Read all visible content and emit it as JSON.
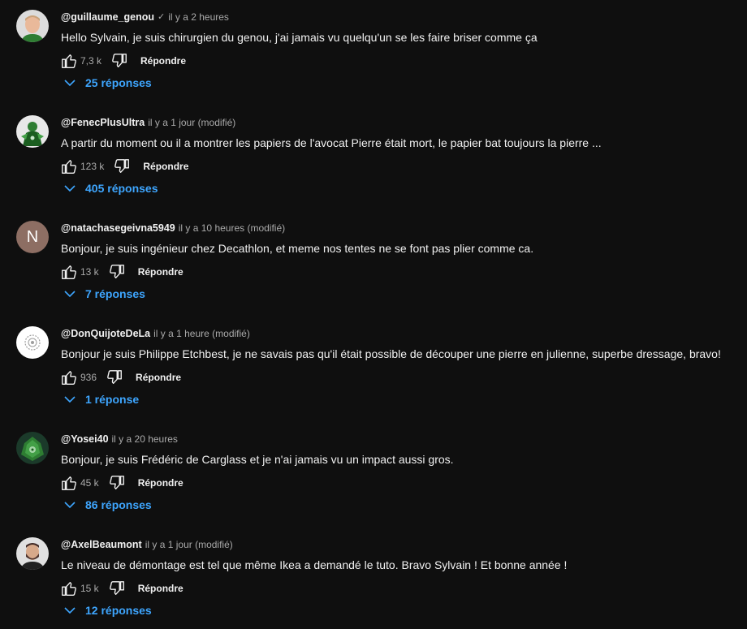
{
  "comments": [
    {
      "author": "@guillaume_genou",
      "verified": "✓",
      "time": "il y a 2 heures",
      "text": "Hello Sylvain, je suis chirurgien du genou, j'ai jamais vu quelqu'un se les faire briser comme ça",
      "likes": "7,3 k",
      "reply_label": "Répondre",
      "replies": "25 réponses",
      "avatar": "man-face"
    },
    {
      "author": "@FenecPlusUltra",
      "time": "il y a 1 jour (modifié)",
      "text": "A partir du moment ou il a montrer les papiers de l'avocat Pierre était mort, le papier bat toujours la pierre ...",
      "likes": "123 k",
      "reply_label": "Répondre",
      "replies": "405 réponses",
      "avatar": "green-hero"
    },
    {
      "author": "@natachasegeivna5949",
      "time": "il y a 10 heures (modifié)",
      "text": "Bonjour, je suis ingénieur chez Decathlon, et meme nos tentes ne se font pas plier comme ca.",
      "likes": "13 k",
      "reply_label": "Répondre",
      "replies": "7 réponses",
      "avatar_letter": "N",
      "avatar_color": "#8d6e63"
    },
    {
      "author": "@DonQuijoteDeLa",
      "time": "il y a 1 heure (modifié)",
      "text": "Bonjour je suis Philippe Etchbest, je ne savais pas qu'il était possible de découper une pierre en julienne, superbe dressage, bravo!",
      "likes": "936",
      "reply_label": "Répondre",
      "replies": "1 réponse",
      "avatar": "white-emblem"
    },
    {
      "author": "@Yosei40",
      "time": "il y a 20 heures",
      "text": "Bonjour, je suis Frédéric de Carglass et je n'ai jamais vu un impact aussi gros.",
      "likes": "45 k",
      "reply_label": "Répondre",
      "replies": "86 réponses",
      "avatar": "green-creature"
    },
    {
      "author": "@AxelBeaumont",
      "time": "il y a 1 jour (modifié)",
      "text": "Le niveau de démontage est tel que même Ikea a demandé le tuto. Bravo Sylvain ! Et bonne année !",
      "likes": "15 k",
      "reply_label": "Répondre",
      "replies": "12 réponses",
      "avatar": "man-beard"
    }
  ],
  "colors": {
    "background": "#0f0f0f",
    "text": "#f1f1f1",
    "muted": "#aaaaaa",
    "link": "#3ea6ff"
  }
}
